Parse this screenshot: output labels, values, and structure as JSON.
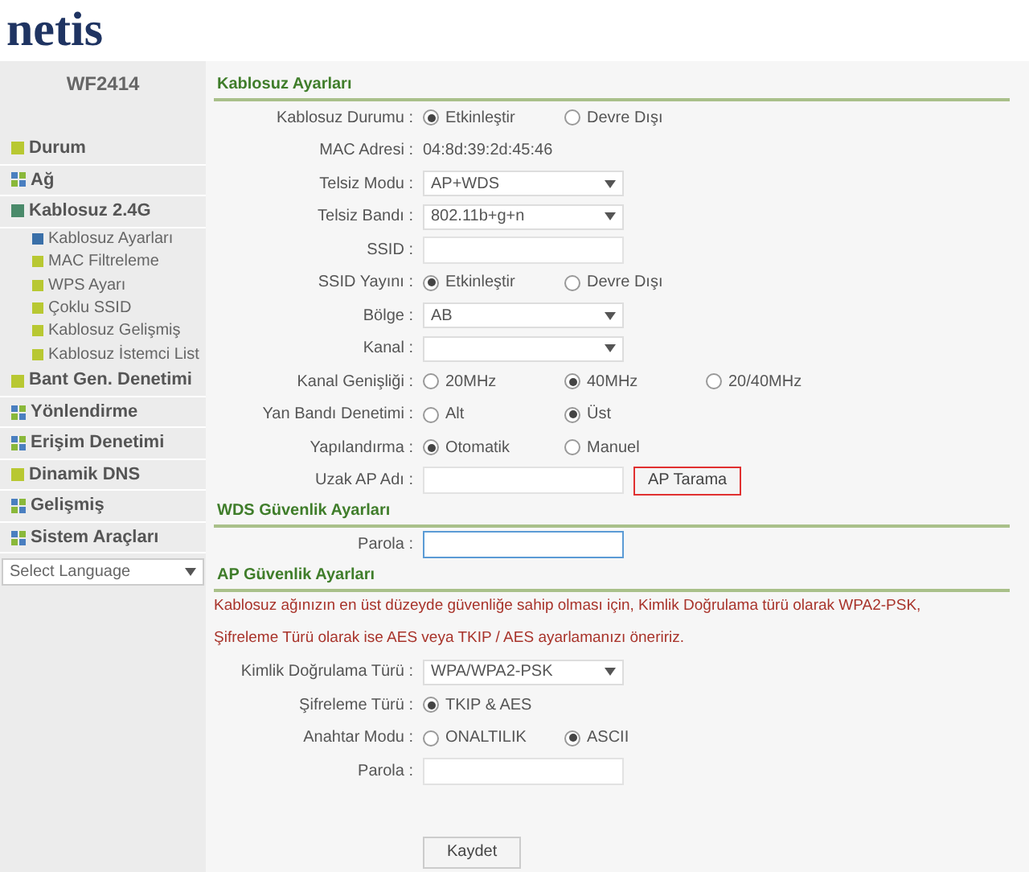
{
  "logo": "netis",
  "sidebar": {
    "model": "WF2414",
    "items": [
      {
        "label": "Durum",
        "kind": "single"
      },
      {
        "label": "Ağ",
        "kind": "group"
      },
      {
        "label": "Kablosuz 2.4G",
        "kind": "open",
        "children": [
          {
            "label": "Kablosuz Ayarları",
            "selected": true
          },
          {
            "label": "MAC Filtreleme",
            "selected": false
          },
          {
            "label": "WPS Ayarı",
            "selected": false
          },
          {
            "label": "Çoklu SSID",
            "selected": false
          },
          {
            "label": "Kablosuz Gelişmiş",
            "selected": false
          },
          {
            "label": "Kablosuz İstemci List",
            "selected": false
          }
        ]
      },
      {
        "label": "Bant Gen. Denetimi",
        "kind": "single"
      },
      {
        "label": "Yönlendirme",
        "kind": "group"
      },
      {
        "label": "Erişim Denetimi",
        "kind": "group"
      },
      {
        "label": "Dinamik DNS",
        "kind": "single"
      },
      {
        "label": "Gelişmiş",
        "kind": "group"
      },
      {
        "label": "Sistem Araçları",
        "kind": "group"
      }
    ],
    "language": {
      "value": "Select Language"
    }
  },
  "sections": [
    {
      "title": "Kablosuz Ayarları",
      "rows": [
        {
          "label": "Kablosuz Durumu :",
          "kind": "radio",
          "options": [
            {
              "label": "Etkinleştir",
              "selected": true
            },
            {
              "label": "Devre Dışı",
              "selected": false
            }
          ]
        },
        {
          "label": "MAC Adresi :",
          "kind": "text",
          "value": "04:8d:39:2d:45:46"
        },
        {
          "label": "Telsiz Modu :",
          "kind": "select",
          "value": "AP+WDS"
        },
        {
          "label": "Telsiz Bandı :",
          "kind": "select",
          "value": "802.11b+g+n"
        },
        {
          "label": "SSID :",
          "kind": "input"
        },
        {
          "label": "SSID Yayını :",
          "kind": "radio",
          "options": [
            {
              "label": "Etkinleştir",
              "selected": true
            },
            {
              "label": "Devre Dışı",
              "selected": false
            }
          ]
        },
        {
          "label": "Bölge :",
          "kind": "select",
          "value": "AB"
        },
        {
          "label": "Kanal :",
          "kind": "select"
        },
        {
          "label": "Kanal Genişliği :",
          "kind": "radio",
          "options": [
            {
              "label": "20MHz",
              "selected": false
            },
            {
              "label": "40MHz",
              "selected": true
            },
            {
              "label": "20/40MHz",
              "selected": false
            }
          ]
        },
        {
          "label": "Yan Bandı Denetimi :",
          "kind": "radio",
          "options": [
            {
              "label": "Alt",
              "selected": false
            },
            {
              "label": "Üst",
              "selected": true
            }
          ]
        },
        {
          "label": "Yapılandırma :",
          "kind": "radio",
          "options": [
            {
              "label": "Otomatik",
              "selected": true
            },
            {
              "label": "Manuel",
              "selected": false
            }
          ]
        },
        {
          "label": "Uzak AP Adı :",
          "kind": "input",
          "button": {
            "label": "AP Tarama",
            "highlighted": true
          }
        }
      ]
    },
    {
      "title": "WDS Güvenlik Ayarları",
      "rows": [
        {
          "label": "Parola :",
          "kind": "input",
          "focused": true
        }
      ]
    },
    {
      "title": "AP Güvenlik Ayarları",
      "notes": [
        "Kablosuz ağınızın en üst düzeyde güvenliğe sahip olması için, Kimlik Doğrulama türü olarak WPA2-PSK,",
        "Şifreleme Türü olarak ise AES veya TKIP / AES ayarlamanızı öneririz."
      ],
      "rows": [
        {
          "label": "Kimlik Doğrulama Türü :",
          "kind": "select",
          "value": "WPA/WPA2-PSK"
        },
        {
          "label": "Şifreleme Türü :",
          "kind": "radio",
          "options": [
            {
              "label": "TKIP & AES",
              "selected": true
            }
          ]
        },
        {
          "label": "Anahtar Modu :",
          "kind": "radio",
          "options": [
            {
              "label": "ONALTILIK",
              "selected": false
            },
            {
              "label": "ASCII",
              "selected": true
            }
          ]
        },
        {
          "label": "Parola :",
          "kind": "input"
        }
      ]
    }
  ],
  "save_button": "Kaydet"
}
